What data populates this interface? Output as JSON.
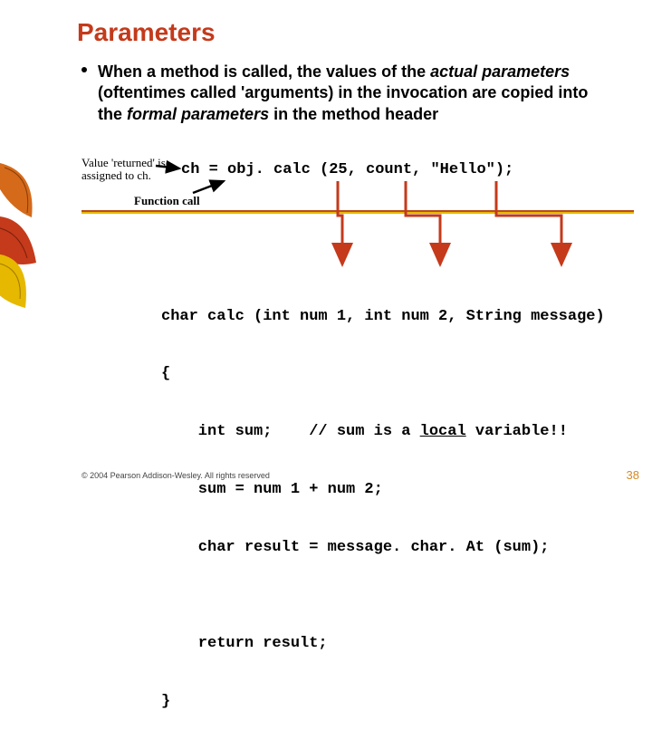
{
  "title": "Parameters",
  "bullet": {
    "pre": "When a method is called, the values of the ",
    "em1": "actual parameters",
    "mid1": " (oftentimes called 'arguments) in the invocation are copied into the ",
    "em2": "formal parameters",
    "post": " in the method header"
  },
  "annotations": {
    "returned_l1": "Value 'returned' is",
    "returned_l2": "assigned to ch.",
    "function_call": "Function call"
  },
  "code_call": "ch = obj. calc (25, count, \"Hello\");",
  "code_def_l1": "char calc (int num 1, int num 2, String message)",
  "code_def_l2": "{",
  "code_def_l3_a": "    int sum;    // sum is a ",
  "code_def_l3_b": "local",
  "code_def_l3_c": " variable!!",
  "code_def_l4": "    sum = num 1 + num 2;",
  "code_def_l5": "    char result = message. char. At (sum);",
  "code_def_l6": "",
  "code_def_l7": "    return result;",
  "code_def_l8": "}",
  "footer": {
    "copyright": "© 2004 Pearson Addison-Wesley. All rights reserved",
    "page": "38"
  },
  "colors": {
    "title": "#c43a1b",
    "arrow": "#c43a1b",
    "divider_top": "#b84c1d",
    "divider_bot": "#e6b800"
  }
}
